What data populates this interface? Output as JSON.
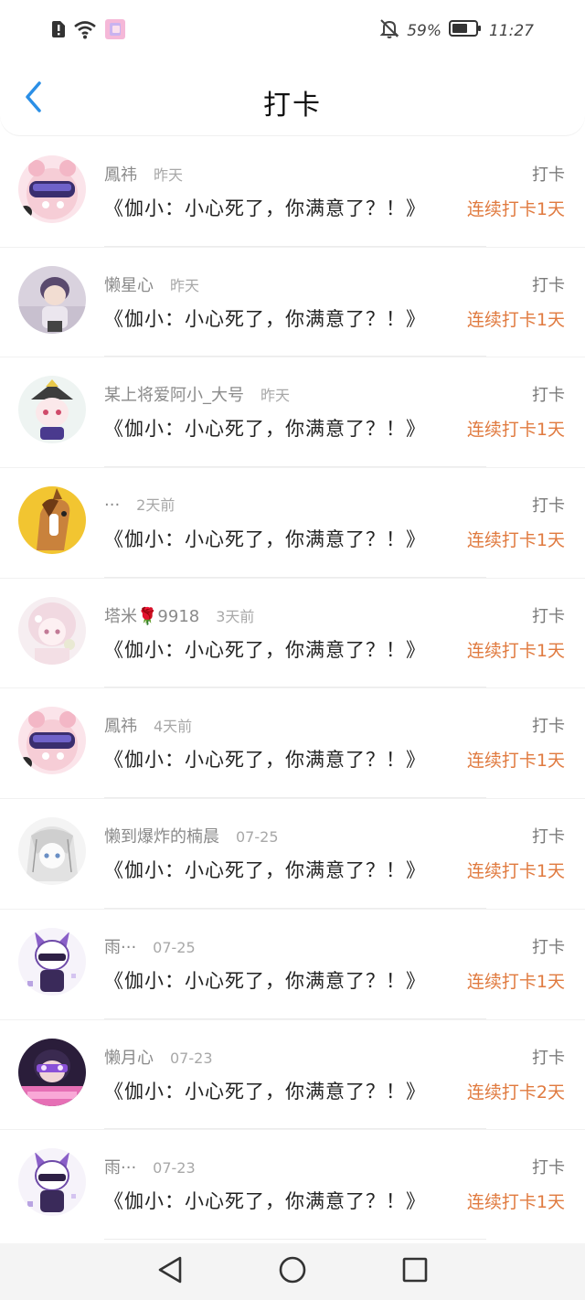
{
  "status_bar": {
    "battery": "59%",
    "time": "11:27",
    "icons": [
      "alert-icon",
      "wifi-icon",
      "app-notification-icon",
      "mute-bell-icon",
      "battery-icon"
    ]
  },
  "header": {
    "title": "打卡",
    "back_icon": "chevron-left-icon"
  },
  "accent_color": "#e07a3f",
  "entries": [
    {
      "user": "鳳祎",
      "time": "昨天",
      "tag": "打卡",
      "message": "《伽小：小心死了，你满意了？！》",
      "streak": "连续打卡1天",
      "avatar": "avatar-pig-goggles"
    },
    {
      "user": "懒星心",
      "time": "昨天",
      "tag": "打卡",
      "message": "《伽小：小心死了，你满意了？！》",
      "streak": "连续打卡1天",
      "avatar": "avatar-boy-purple"
    },
    {
      "user": "某上将爱阿小_大号",
      "time": "昨天",
      "tag": "打卡",
      "message": "《伽小：小心死了，你满意了？！》",
      "streak": "连续打卡1天",
      "avatar": "avatar-bird-hat"
    },
    {
      "user": "···",
      "time": "2天前",
      "tag": "打卡",
      "message": "《伽小：小心死了，你满意了？！》",
      "streak": "连续打卡1天",
      "avatar": "avatar-horse"
    },
    {
      "user": "塔米🌹9918",
      "time": "3天前",
      "tag": "打卡",
      "message": "《伽小：小心死了，你满意了？！》",
      "streak": "连续打卡1天",
      "avatar": "avatar-pink-girl"
    },
    {
      "user": "鳳祎",
      "time": "4天前",
      "tag": "打卡",
      "message": "《伽小：小心死了，你满意了？！》",
      "streak": "连续打卡1天",
      "avatar": "avatar-pig-goggles"
    },
    {
      "user": "懒到爆炸的楠晨",
      "time": "07-25",
      "tag": "打卡",
      "message": "《伽小：小心死了，你满意了？！》",
      "streak": "连续打卡1天",
      "avatar": "avatar-sketch-girl"
    },
    {
      "user": "雨···",
      "time": "07-25",
      "tag": "打卡",
      "message": "《伽小：小心死了，你满意了？！》",
      "streak": "连续打卡1天",
      "avatar": "avatar-masked-hero"
    },
    {
      "user": "懒月心",
      "time": "07-23",
      "tag": "打卡",
      "message": "《伽小：小心死了，你满意了？！》",
      "streak": "连续打卡2天",
      "avatar": "avatar-goggles-pink"
    },
    {
      "user": "雨···",
      "time": "07-23",
      "tag": "打卡",
      "message": "《伽小：小心死了，你满意了？！》",
      "streak": "连续打卡1天",
      "avatar": "avatar-masked-hero"
    }
  ],
  "nav_bar": {
    "buttons": [
      "back-triangle-icon",
      "home-circle-icon",
      "recents-square-icon"
    ]
  }
}
